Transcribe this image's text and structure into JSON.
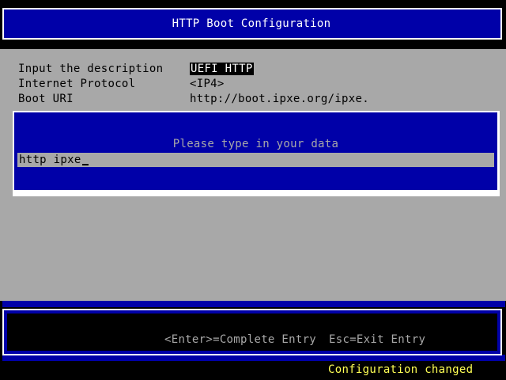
{
  "window": {
    "title": "HTTP Boot Configuration"
  },
  "form": {
    "rows": [
      {
        "label": "Input the description",
        "value": "UEFI HTTP"
      },
      {
        "label": "Internet Protocol",
        "value": "<IP4>"
      },
      {
        "label": "Boot URI",
        "value": "http://boot.ipxe.org/ipxe."
      }
    ]
  },
  "dialog": {
    "prompt": "Please type in your data",
    "input_value": "http ipxe"
  },
  "footer": {
    "enter_hint": "<Enter>=Complete Entry",
    "esc_hint": "Esc=Exit Entry"
  },
  "status": {
    "text": "Configuration changed"
  },
  "colors": {
    "blue": "#0000a8",
    "gray": "#a8a8a8",
    "status_yellow": "#ffff55"
  }
}
